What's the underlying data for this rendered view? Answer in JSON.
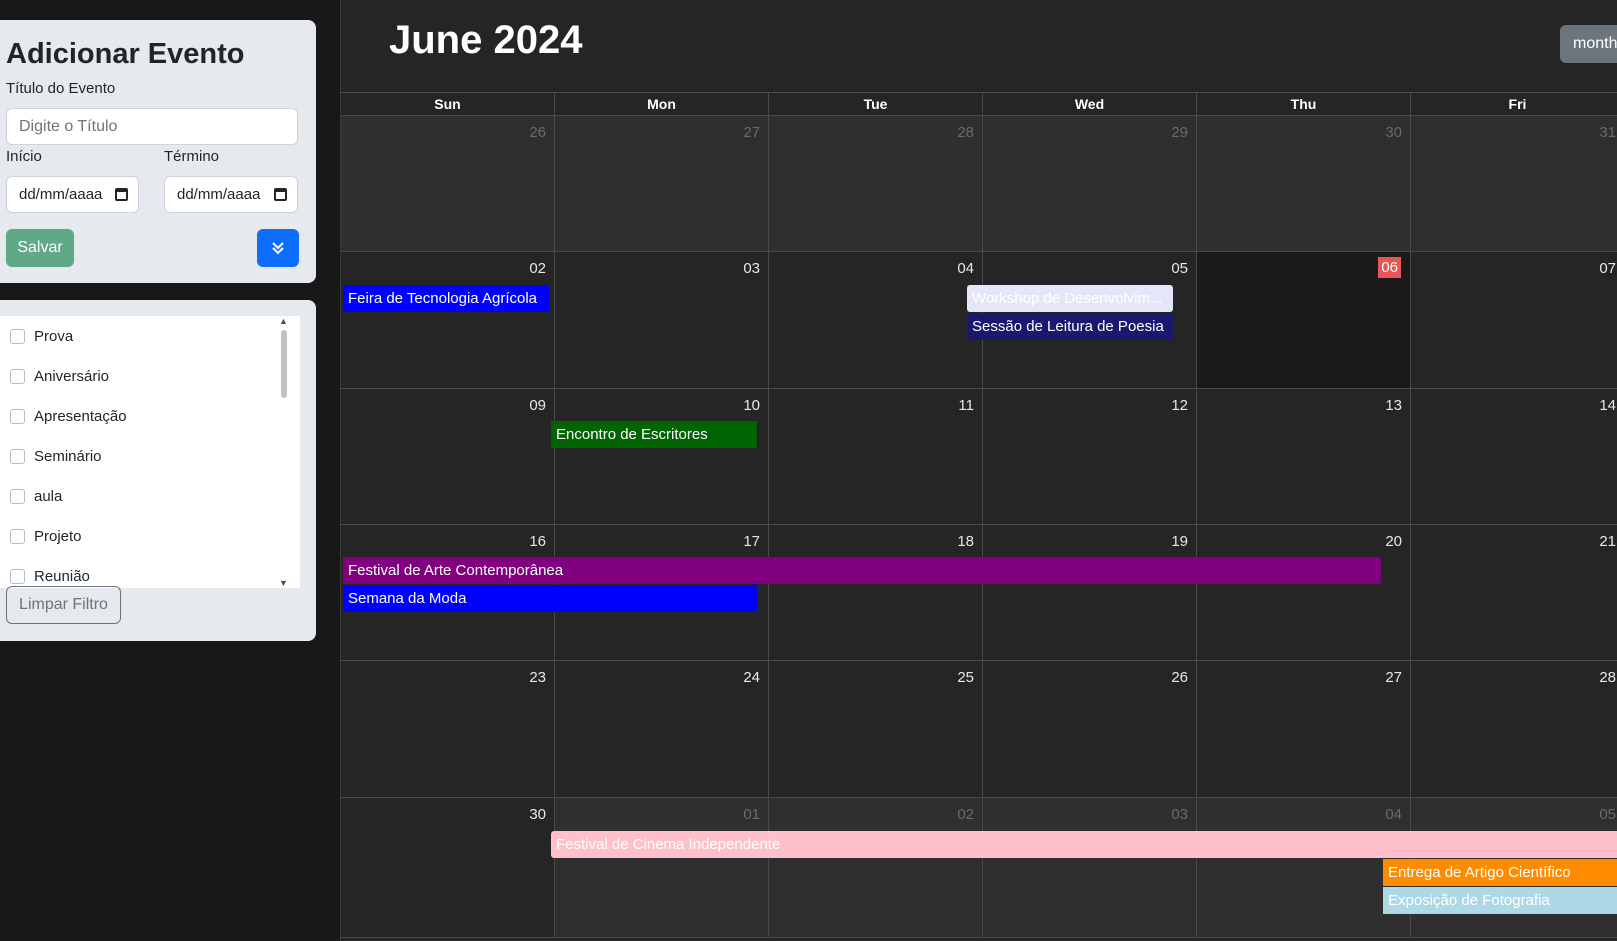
{
  "form": {
    "title": "Adicionar Evento",
    "event_title_label": "Título do Evento",
    "event_title_placeholder": "Digite o Título",
    "start_label": "Início",
    "end_label": "Término",
    "start_value": "dd/mm/aaaa",
    "end_value": "dd/mm/aaaa",
    "save_label": "Salvar"
  },
  "filters": {
    "items": [
      "Prova",
      "Aniversário",
      "Apresentação",
      "Seminário",
      "aula",
      "Projeto",
      "Reunião"
    ],
    "clear_label": "Limpar Filtro"
  },
  "calendar": {
    "title": "June 2024",
    "view_button": "month",
    "weekdays": [
      "Sun",
      "Mon",
      "Tue",
      "Wed",
      "Thu",
      "Fri"
    ],
    "weeks": [
      [
        "26",
        "27",
        "28",
        "29",
        "30",
        "31"
      ],
      [
        "02",
        "03",
        "04",
        "05",
        "06",
        "07"
      ],
      [
        "09",
        "10",
        "11",
        "12",
        "13",
        "14"
      ],
      [
        "16",
        "17",
        "18",
        "19",
        "20",
        "21"
      ],
      [
        "23",
        "24",
        "25",
        "26",
        "27",
        "28"
      ],
      [
        "30",
        "01",
        "02",
        "03",
        "04",
        "05"
      ]
    ],
    "today": "06",
    "events": [
      {
        "title": "Feira de Tecnologia Agrícola",
        "color": "#0000ff"
      },
      {
        "title": "Workshop de Desenvolvim...",
        "color": "#e6e6fa"
      },
      {
        "title": "Sessão de Leitura de Poesia",
        "color": "#191970"
      },
      {
        "title": "Encontro de Escritores",
        "color": "#006400"
      },
      {
        "title": "Festival de Arte Contemporânea",
        "color": "#800080"
      },
      {
        "title": "Semana da Moda",
        "color": "#0000ff"
      },
      {
        "title": "Festival de Cinema Independente",
        "color": "#ffc0cb"
      },
      {
        "title": "Entrega de Artigo Científico",
        "color": "#ff8c00"
      },
      {
        "title": "Exposição de Fotografia",
        "color": "#add8e6"
      }
    ]
  }
}
